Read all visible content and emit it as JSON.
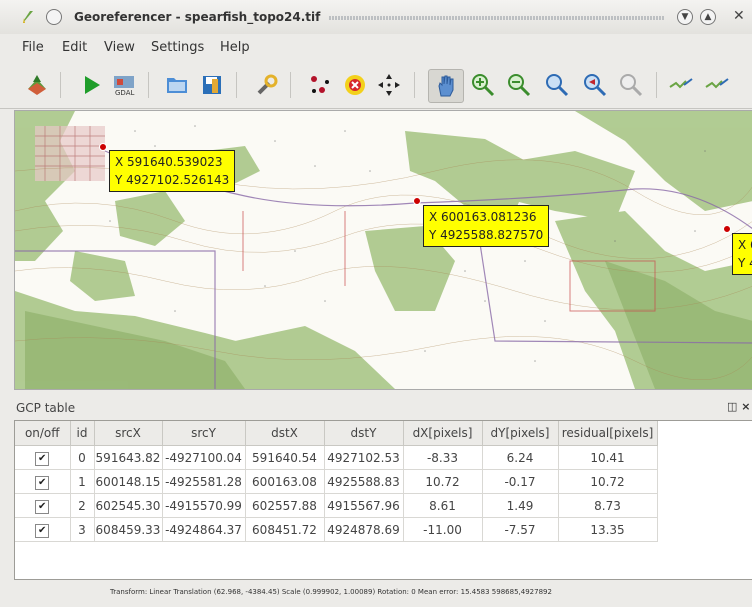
{
  "window": {
    "title": "Georeferencer - spearfish_topo24.tif"
  },
  "menu": {
    "items": [
      "File",
      "Edit",
      "View",
      "Settings",
      "Help"
    ]
  },
  "toolbar": {
    "icons": [
      "open-raster-icon",
      "start-georeferencing-icon",
      "generate-gdal-script-icon",
      "load-gcp-points-icon",
      "save-gcp-points-icon",
      "transformation-settings-icon",
      "add-point-icon",
      "delete-point-icon",
      "move-gcp-point-icon",
      "pan-icon",
      "zoom-in-icon",
      "zoom-out-icon",
      "zoom-to-layer-icon",
      "zoom-last-icon",
      "zoom-next-icon",
      "link-georeferencer-to-qgis-icon",
      "link-qgis-to-georeferencer-icon"
    ]
  },
  "map": {
    "callouts": [
      {
        "x_label": "X 591640.539023",
        "y_label": "Y 4927102.526143"
      },
      {
        "x_label": "X 600163.081236",
        "y_label": "Y 4925588.827570"
      },
      {
        "x_label": "X 6",
        "y_label": "Y 4"
      }
    ]
  },
  "gcp_table": {
    "title": "GCP table",
    "close_label": "×",
    "columns": [
      "on/off",
      "id",
      "srcX",
      "srcY",
      "dstX",
      "dstY",
      "dX[pixels]",
      "dY[pixels]",
      "residual[pixels]"
    ],
    "rows": [
      {
        "checked": "✔",
        "id": "0",
        "srcX": "591643.82",
        "srcY": "-4927100.04",
        "dstX": "591640.54",
        "dstY": "4927102.53",
        "dX": "-8.33",
        "dY": "6.24",
        "residual": "10.41"
      },
      {
        "checked": "✔",
        "id": "1",
        "srcX": "600148.15",
        "srcY": "-4925581.28",
        "dstX": "600163.08",
        "dstY": "4925588.83",
        "dX": "10.72",
        "dY": "-0.17",
        "residual": "10.72"
      },
      {
        "checked": "✔",
        "id": "2",
        "srcX": "602545.30",
        "srcY": "-4915570.99",
        "dstX": "602557.88",
        "dstY": "4915567.96",
        "dX": "8.61",
        "dY": "1.49",
        "residual": "8.73"
      },
      {
        "checked": "✔",
        "id": "3",
        "srcX": "608459.33",
        "srcY": "-4924864.37",
        "dstX": "608451.72",
        "dstY": "4924878.69",
        "dX": "-11.00",
        "dY": "-7.57",
        "residual": "13.35"
      }
    ]
  },
  "status": {
    "text": "Transform: Linear Translation (62.968, -4384.45) Scale (0.999902, 1.00089) Rotation: 0 Mean error: 15.4583    598685,4927892"
  },
  "colors": {
    "callout_background": "#ffff00",
    "gcp_marker": "#cc0000",
    "terrain_green": "#9fbe7e"
  }
}
